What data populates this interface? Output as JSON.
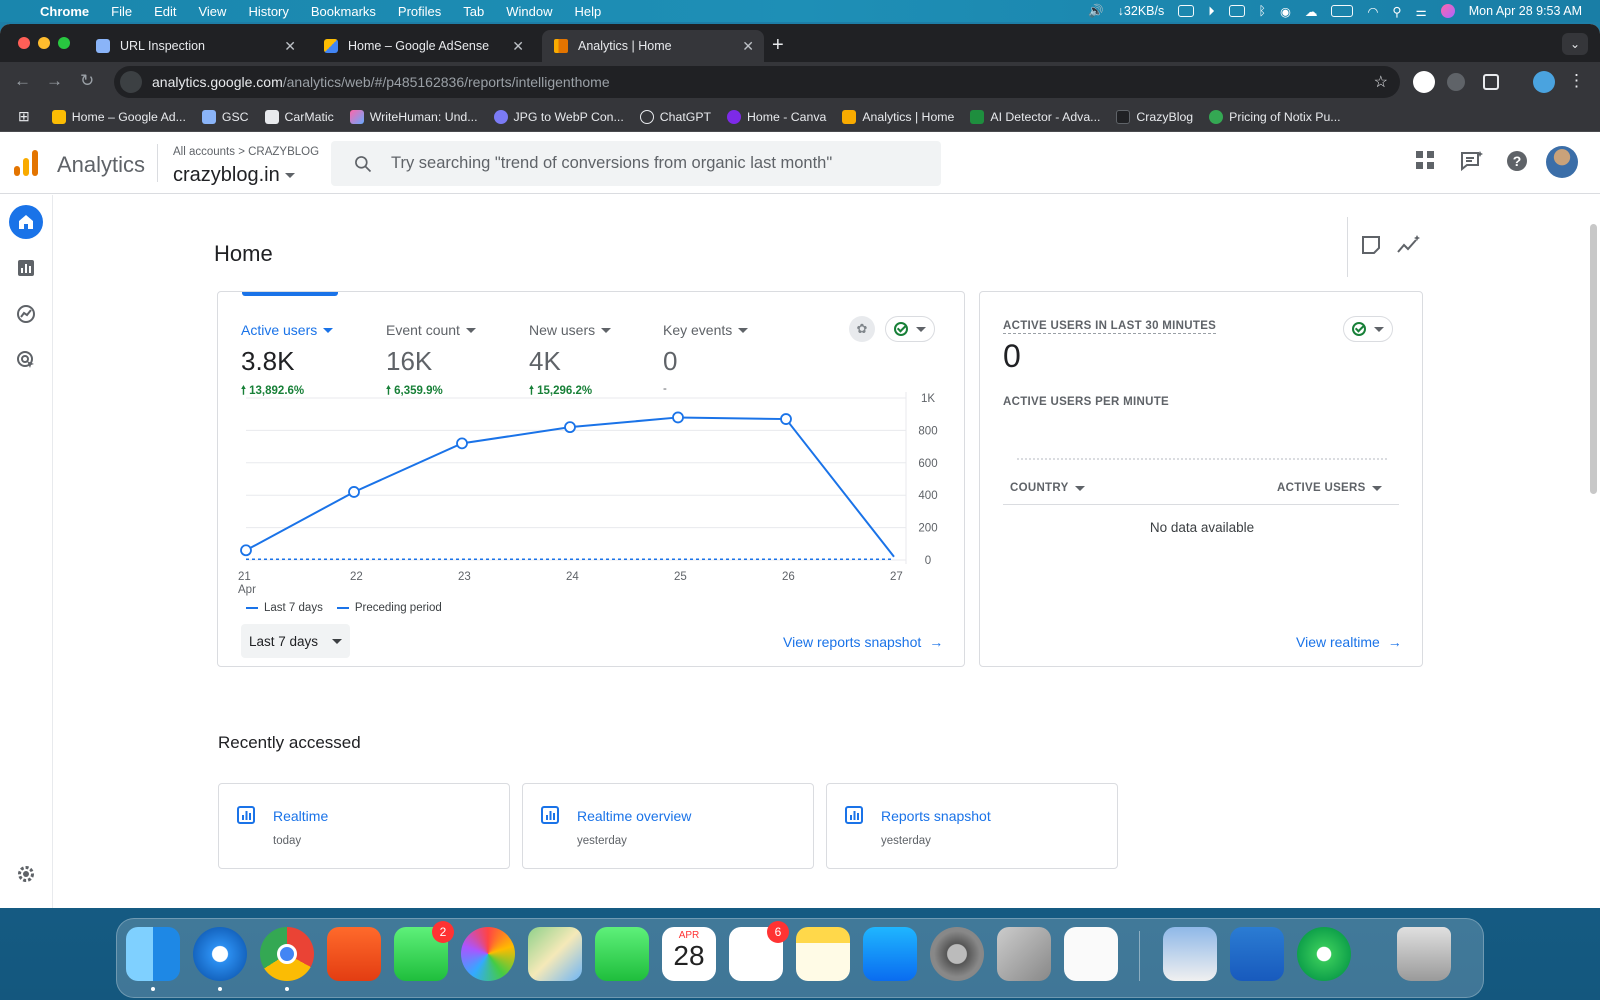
{
  "menubar": {
    "app": "Chrome",
    "items": [
      "File",
      "Edit",
      "View",
      "History",
      "Bookmarks",
      "Profiles",
      "Tab",
      "Window",
      "Help"
    ],
    "net": "↓32KB/s",
    "datetime": "Mon Apr 28  9:53 AM"
  },
  "tabs": [
    {
      "title": "URL Inspection"
    },
    {
      "title": "Home – Google AdSense"
    },
    {
      "title": "Analytics | Home"
    }
  ],
  "omnibox": {
    "host": "analytics.google.com",
    "path": "/analytics/web/#/p485162836/reports/intelligenthome"
  },
  "bookmarks": [
    "Home – Google Ad...",
    "GSC",
    "CarMatic",
    "WriteHuman: Und...",
    "JPG to WebP Con...",
    "ChatGPT",
    "Home - Canva",
    "Analytics | Home",
    "AI Detector - Adva...",
    "CrazyBlog",
    "Pricing of Notix Pu..."
  ],
  "ga": {
    "product": "Analytics",
    "account_path": "All accounts  >  CRAZYBLOG",
    "property": "crazyblog.in",
    "search_placeholder": "Try searching \"trend of conversions from organic last month\""
  },
  "home": {
    "title": "Home",
    "metrics": [
      {
        "label": "Active users",
        "value": "3.8K",
        "change": "13,892.6%"
      },
      {
        "label": "Event count",
        "value": "16K",
        "change": "6,359.9%"
      },
      {
        "label": "New users",
        "value": "4K",
        "change": "15,296.2%"
      },
      {
        "label": "Key events",
        "value": "0",
        "change": "-"
      }
    ],
    "legend": {
      "current": "Last 7 days",
      "previous": "Preceding period"
    },
    "date_range": "Last 7 days",
    "view_snapshot": "View reports snapshot"
  },
  "chart_data": {
    "type": "line",
    "categories": [
      "21",
      "22",
      "23",
      "24",
      "25",
      "26",
      "27"
    ],
    "x_sublabel": "Apr",
    "series": [
      {
        "name": "Last 7 days",
        "values": [
          60,
          420,
          720,
          820,
          880,
          870,
          20
        ]
      },
      {
        "name": "Preceding period",
        "values": [
          5,
          5,
          5,
          5,
          5,
          5,
          5
        ]
      }
    ],
    "yticks": [
      "0",
      "200",
      "400",
      "600",
      "800",
      "1K"
    ],
    "ylim": [
      0,
      1000
    ],
    "grid": true,
    "legend": "bottom-left",
    "colors": {
      "current": "#1a73e8",
      "previous": "#1a73e8"
    }
  },
  "realtime": {
    "heading": "ACTIVE USERS IN LAST 30 MINUTES",
    "value": "0",
    "per_minute": "ACTIVE USERS PER MINUTE",
    "col_country": "COUNTRY",
    "col_users": "ACTIVE USERS",
    "empty": "No data available",
    "view_realtime": "View realtime"
  },
  "recent": {
    "title": "Recently accessed",
    "items": [
      {
        "title": "Realtime",
        "sub": "today"
      },
      {
        "title": "Realtime overview",
        "sub": "yesterday"
      },
      {
        "title": "Reports snapshot",
        "sub": "yesterday"
      }
    ]
  },
  "dock": {
    "calendar_month": "APR",
    "calendar_day": "28",
    "messages_badge": "2",
    "reminders_badge": "6",
    "apps": [
      "finder",
      "safari",
      "chrome",
      "brave",
      "messages",
      "photos",
      "maps",
      "facetime",
      "calendar",
      "reminders",
      "notes",
      "app-store",
      "system-settings",
      "iphone-mirroring",
      "textedit",
      "preview",
      "word",
      "find-my",
      "trash"
    ]
  }
}
